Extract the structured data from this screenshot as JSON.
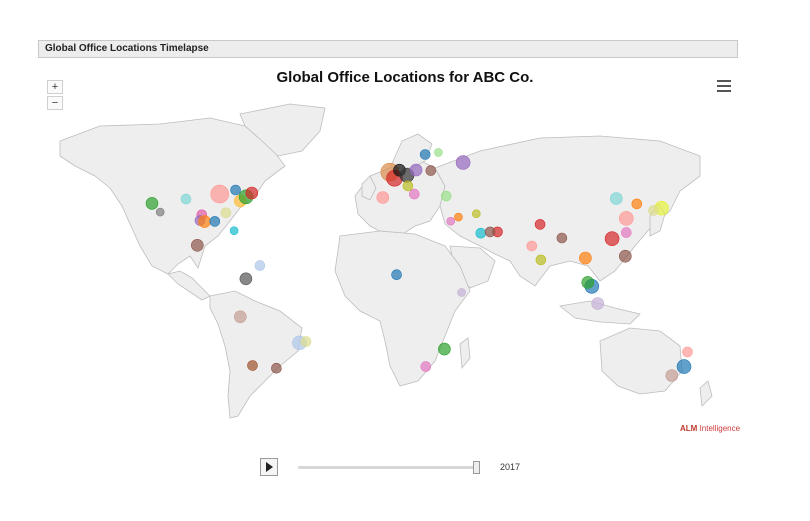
{
  "panel": {
    "title": "Global Office Locations Timelapse"
  },
  "chart": {
    "title": "Global Office Locations for ABC Co.",
    "zoom_in": "+",
    "zoom_out": "−",
    "menu_icon": "hamburger-menu-icon",
    "credit_brand": "ALM",
    "credit_text": "Intelligence",
    "land_color": "#eeeeee",
    "border_color": "#bdbdbd"
  },
  "timeline": {
    "current_year": "2017",
    "play_icon": "play-icon",
    "progress": 1.0
  },
  "chart_data": {
    "type": "bubble-map",
    "title": "Global Office Locations for ABC Co.",
    "year": "2017",
    "points": [
      {
        "lon": -122.4,
        "lat": 37.8,
        "color": "#2ca02c",
        "size": 6
      },
      {
        "lon": -118.2,
        "lat": 34.0,
        "color": "#7f7f7f",
        "size": 4
      },
      {
        "lon": -104.9,
        "lat": 39.7,
        "color": "#7fd6d6",
        "size": 5
      },
      {
        "lon": -96.8,
        "lat": 32.8,
        "color": "#e15aa8",
        "size": 5
      },
      {
        "lon": -97.7,
        "lat": 30.3,
        "color": "#9467bd",
        "size": 5
      },
      {
        "lon": -95.4,
        "lat": 29.8,
        "color": "#ff7f0e",
        "size": 6
      },
      {
        "lon": -90.1,
        "lat": 29.9,
        "color": "#1f77b4",
        "size": 5
      },
      {
        "lon": -87.6,
        "lat": 41.9,
        "color": "#ff9896",
        "size": 9
      },
      {
        "lon": -84.4,
        "lat": 33.7,
        "color": "#dbdb8d",
        "size": 5
      },
      {
        "lon": -80.2,
        "lat": 25.8,
        "color": "#17becf",
        "size": 4
      },
      {
        "lon": -77.0,
        "lat": 38.9,
        "color": "#ffbb33",
        "size": 6
      },
      {
        "lon": -74.0,
        "lat": 40.7,
        "color": "#2ca02c",
        "size": 7
      },
      {
        "lon": -71.1,
        "lat": 42.4,
        "color": "#d62728",
        "size": 6
      },
      {
        "lon": -79.4,
        "lat": 43.7,
        "color": "#1f77b4",
        "size": 5
      },
      {
        "lon": -99.1,
        "lat": 19.4,
        "color": "#8c564b",
        "size": 6
      },
      {
        "lon": -74.1,
        "lat": 4.7,
        "color": "#555555",
        "size": 6
      },
      {
        "lon": -66.9,
        "lat": 10.5,
        "color": "#aec7e8",
        "size": 5
      },
      {
        "lon": -77.0,
        "lat": -12.0,
        "color": "#c49c94",
        "size": 6
      },
      {
        "lon": -46.6,
        "lat": -23.5,
        "color": "#aec7e8",
        "size": 7
      },
      {
        "lon": -43.2,
        "lat": -22.9,
        "color": "#dbdb8d",
        "size": 5
      },
      {
        "lon": -70.7,
        "lat": -33.4,
        "color": "#a0522d",
        "size": 5
      },
      {
        "lon": -58.4,
        "lat": -34.6,
        "color": "#8c564b",
        "size": 5
      },
      {
        "lon": -0.1,
        "lat": 51.5,
        "color": "#d98c4a",
        "size": 9
      },
      {
        "lon": 2.3,
        "lat": 48.9,
        "color": "#d62728",
        "size": 8
      },
      {
        "lon": 4.9,
        "lat": 52.4,
        "color": "#111111",
        "size": 6
      },
      {
        "lon": 8.7,
        "lat": 50.1,
        "color": "#333333",
        "size": 7
      },
      {
        "lon": 13.4,
        "lat": 52.5,
        "color": "#9467bd",
        "size": 6
      },
      {
        "lon": 12.5,
        "lat": 41.9,
        "color": "#e377c2",
        "size": 5
      },
      {
        "lon": 9.2,
        "lat": 45.5,
        "color": "#bcbd22",
        "size": 5
      },
      {
        "lon": -3.7,
        "lat": 40.4,
        "color": "#ff9896",
        "size": 6
      },
      {
        "lon": 18.1,
        "lat": 59.3,
        "color": "#1f77b4",
        "size": 5
      },
      {
        "lon": 21.0,
        "lat": 52.2,
        "color": "#8c564b",
        "size": 5
      },
      {
        "lon": 24.9,
        "lat": 60.2,
        "color": "#98df8a",
        "size": 4
      },
      {
        "lon": 37.6,
        "lat": 55.8,
        "color": "#9467bd",
        "size": 7
      },
      {
        "lon": 28.9,
        "lat": 41.0,
        "color": "#98df8a",
        "size": 5
      },
      {
        "lon": 31.2,
        "lat": 30.0,
        "color": "#e377c2",
        "size": 4
      },
      {
        "lon": 35.2,
        "lat": 31.8,
        "color": "#ff7f0e",
        "size": 4
      },
      {
        "lon": 46.7,
        "lat": 24.7,
        "color": "#17becf",
        "size": 5
      },
      {
        "lon": 55.3,
        "lat": 25.3,
        "color": "#d62728",
        "size": 5
      },
      {
        "lon": 51.5,
        "lat": 25.3,
        "color": "#8c564b",
        "size": 5
      },
      {
        "lon": 44.4,
        "lat": 33.3,
        "color": "#bcbd22",
        "size": 4
      },
      {
        "lon": 3.4,
        "lat": 6.5,
        "color": "#1f77b4",
        "size": 5
      },
      {
        "lon": 36.8,
        "lat": -1.3,
        "color": "#c5b0d5",
        "size": 4
      },
      {
        "lon": 28.0,
        "lat": -26.2,
        "color": "#2ca02c",
        "size": 6
      },
      {
        "lon": 18.4,
        "lat": -33.9,
        "color": "#e377c2",
        "size": 5
      },
      {
        "lon": 72.9,
        "lat": 19.1,
        "color": "#ff9896",
        "size": 5
      },
      {
        "lon": 77.2,
        "lat": 28.6,
        "color": "#d62728",
        "size": 5
      },
      {
        "lon": 77.6,
        "lat": 13.0,
        "color": "#bcbd22",
        "size": 5
      },
      {
        "lon": 88.4,
        "lat": 22.6,
        "color": "#8c564b",
        "size": 5
      },
      {
        "lon": 100.5,
        "lat": 13.8,
        "color": "#ff7f0e",
        "size": 6
      },
      {
        "lon": 103.8,
        "lat": 1.4,
        "color": "#1f77b4",
        "size": 7
      },
      {
        "lon": 101.7,
        "lat": 3.1,
        "color": "#2ca02c",
        "size": 6
      },
      {
        "lon": 106.8,
        "lat": -6.2,
        "color": "#c5b0d5",
        "size": 6
      },
      {
        "lon": 114.2,
        "lat": 22.3,
        "color": "#d62728",
        "size": 7
      },
      {
        "lon": 121.5,
        "lat": 31.2,
        "color": "#ff9896",
        "size": 7
      },
      {
        "lon": 116.4,
        "lat": 39.9,
        "color": "#7fd6d6",
        "size": 6
      },
      {
        "lon": 121.5,
        "lat": 25.0,
        "color": "#e377c2",
        "size": 5
      },
      {
        "lon": 121.0,
        "lat": 14.6,
        "color": "#8c564b",
        "size": 6
      },
      {
        "lon": 126.9,
        "lat": 37.6,
        "color": "#ff7f0e",
        "size": 5
      },
      {
        "lon": 139.7,
        "lat": 35.7,
        "color": "#e7f23a",
        "size": 7
      },
      {
        "lon": 135.5,
        "lat": 34.7,
        "color": "#dbdb8d",
        "size": 5
      },
      {
        "lon": 151.2,
        "lat": -33.9,
        "color": "#1f77b4",
        "size": 7
      },
      {
        "lon": 144.9,
        "lat": -37.8,
        "color": "#c49c94",
        "size": 6
      },
      {
        "lon": 153.0,
        "lat": -27.5,
        "color": "#ff9896",
        "size": 5
      }
    ]
  }
}
